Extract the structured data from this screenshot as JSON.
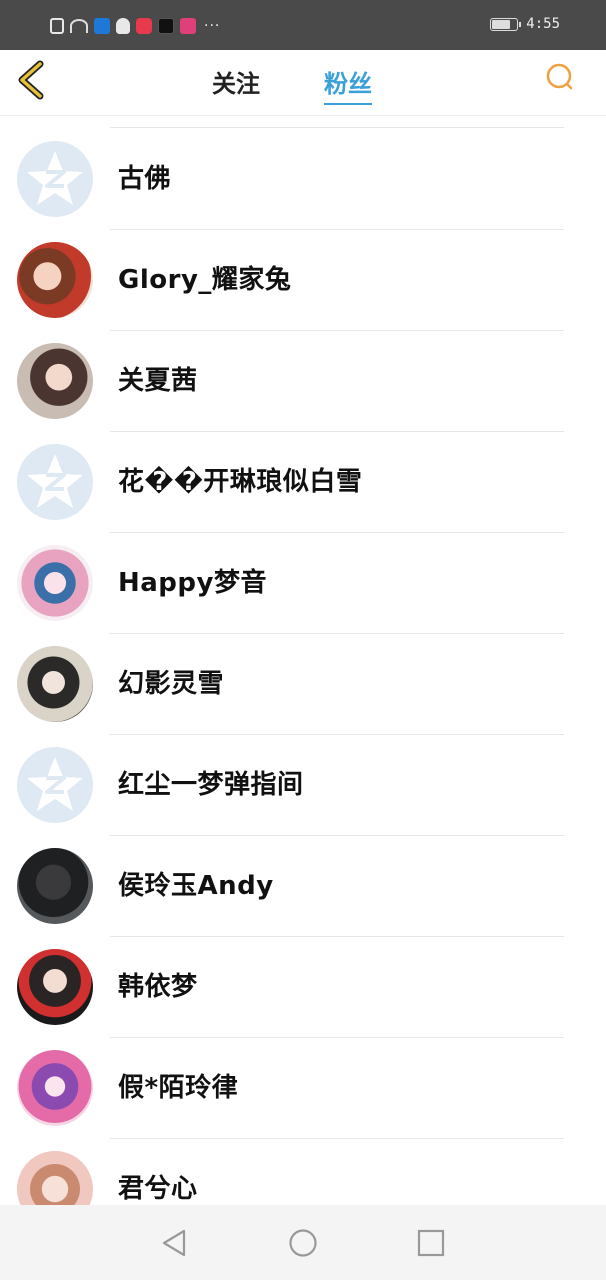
{
  "status_bar": {
    "time": "4:55",
    "more": "···",
    "battery_level": 0.8,
    "icons": [
      "alert-icon",
      "wifi-icon",
      "shield-app-icon",
      "qq-icon",
      "music-app-icon",
      "tiktok-icon",
      "calendar-app-icon"
    ]
  },
  "header": {
    "tabs": [
      {
        "label": "关注",
        "active": false
      },
      {
        "label": "粉丝",
        "active": true
      }
    ],
    "accent_color": "#3aa0d8",
    "back_icon_color": "#e0b020",
    "search_icon_color": "#f0a040"
  },
  "fans": [
    {
      "name": "古佛",
      "avatar": "default-qzone-avatar"
    },
    {
      "name": "Glory_耀家兔",
      "avatar": "cartoon-girl-red-dress"
    },
    {
      "name": "关夏茜",
      "avatar": "photo-girl-long-hair"
    },
    {
      "name": "花��开琳琅似白雪",
      "avatar": "default-qzone-avatar"
    },
    {
      "name": "Happy梦音",
      "avatar": "anime-girl-pink"
    },
    {
      "name": "幻影灵雪",
      "avatar": "photo-girl-dark-frame"
    },
    {
      "name": "红尘一梦弹指间",
      "avatar": "default-qzone-avatar"
    },
    {
      "name": "侯玲玉Andy",
      "avatar": "dark-gorilla-photo"
    },
    {
      "name": "韩依梦",
      "avatar": "photo-girl-red-shirt"
    },
    {
      "name": "假*陌玲律",
      "avatar": "anime-girl-purple"
    },
    {
      "name": "君兮心",
      "avatar": "photo-girl-light"
    }
  ],
  "nav_bar": {
    "buttons": [
      "back-triangle-icon",
      "home-circle-icon",
      "recents-square-icon"
    ]
  }
}
